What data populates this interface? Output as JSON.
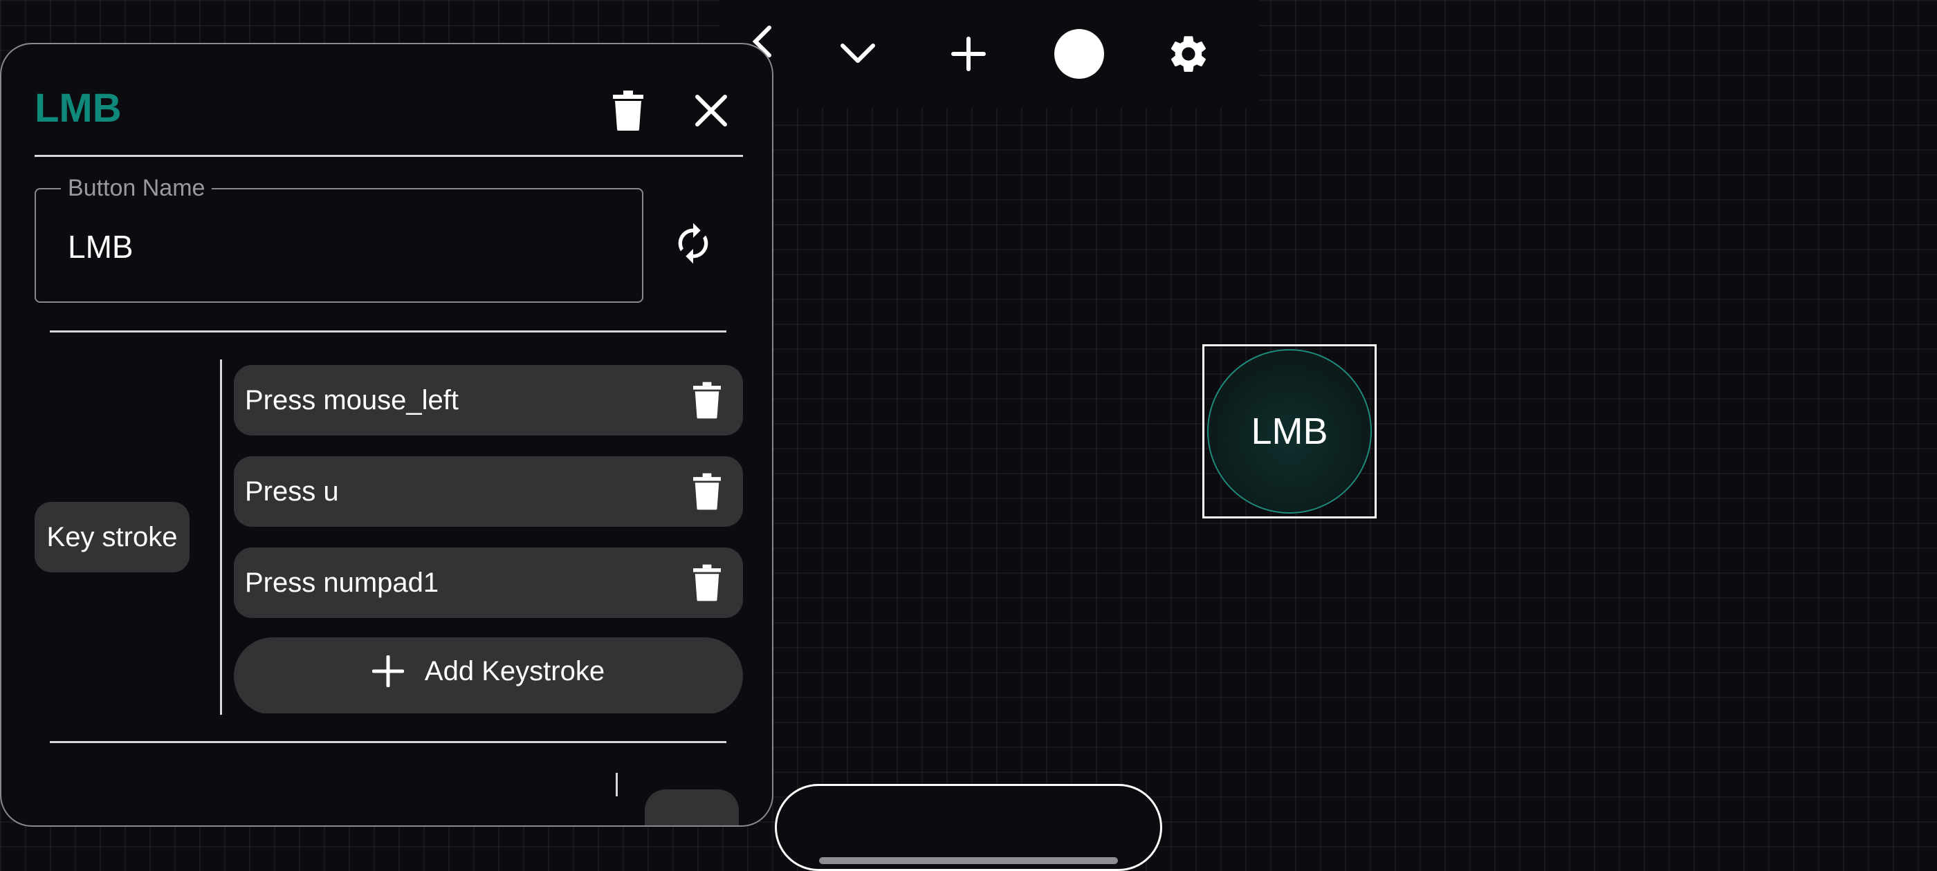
{
  "toolbar": {
    "icons": [
      "back-icon",
      "chevron-down-icon",
      "plus-icon",
      "circle-icon",
      "gear-icon"
    ]
  },
  "editor": {
    "title": "LMB",
    "button_name_label": "Button Name",
    "button_name_value": "LMB",
    "action_type": "Key stroke",
    "keystrokes": [
      {
        "label": "Press mouse_left"
      },
      {
        "label": "Press u"
      },
      {
        "label": "Press numpad1"
      }
    ],
    "add_keystroke_label": "Add Keystroke"
  },
  "canvas": {
    "selected_button_label": "LMB"
  },
  "colors": {
    "accent": "#0f8a7a",
    "background": "#0c0b0f",
    "chip": "#333336",
    "ring": "#1e8a7c"
  }
}
